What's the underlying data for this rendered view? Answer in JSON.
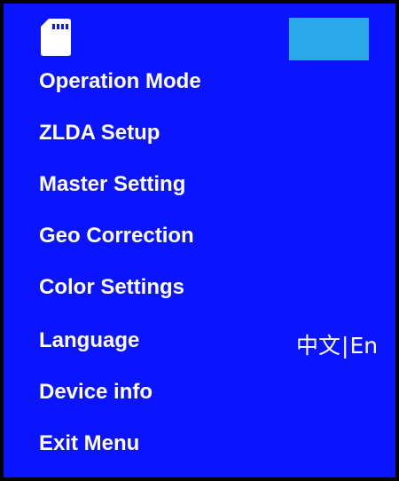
{
  "status": {
    "color": "#29a9e8"
  },
  "icons": {
    "storage": "sd-card-icon"
  },
  "menu": {
    "items": [
      {
        "label": "Operation Mode"
      },
      {
        "label": "ZLDA Setup"
      },
      {
        "label": "Master Setting"
      },
      {
        "label": "Geo Correction"
      },
      {
        "label": "Color Settings"
      },
      {
        "label": "Language"
      },
      {
        "label": "Device info"
      },
      {
        "label": "Exit Menu"
      }
    ]
  },
  "language": {
    "option_chinese": "中文",
    "separator": "|",
    "option_english": "En"
  },
  "colors": {
    "background": "#0a14ff",
    "text": "#ffffff",
    "border": "#000000"
  }
}
